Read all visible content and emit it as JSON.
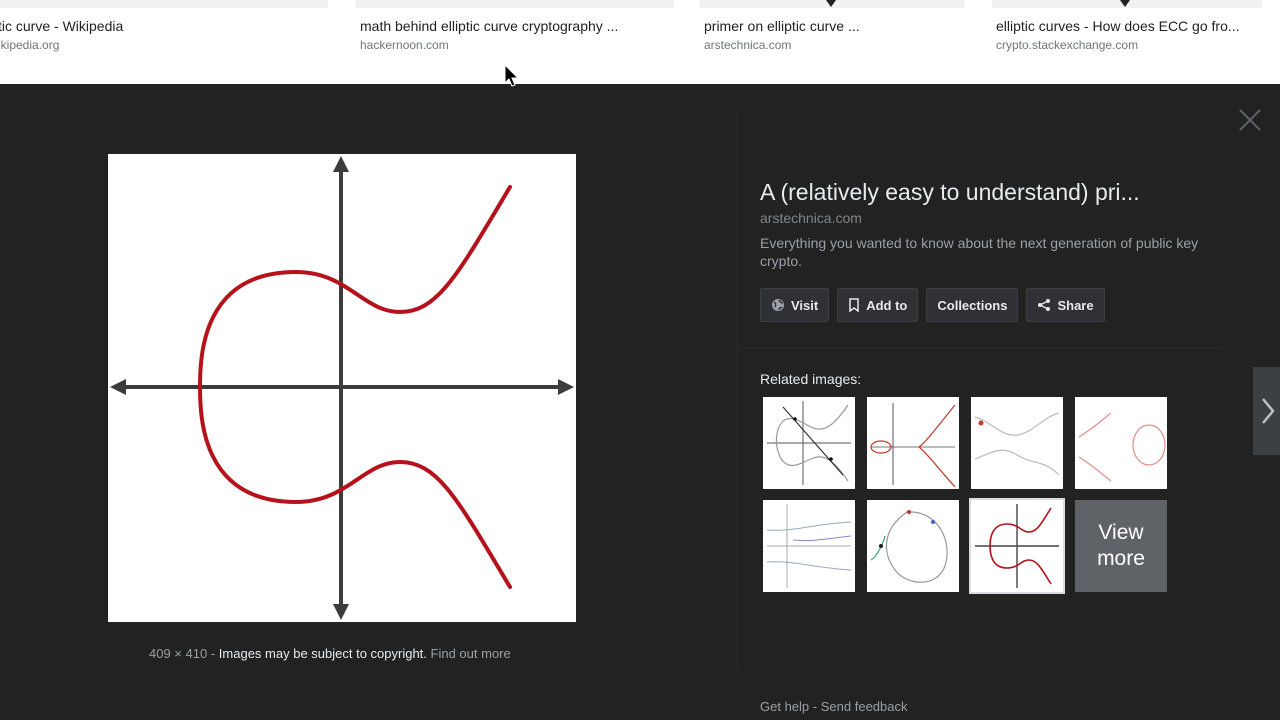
{
  "top_results": [
    {
      "title": "tic curve - Wikipedia",
      "domain": "ikipedia.org"
    },
    {
      "title": "math behind elliptic curve cryptography ...",
      "domain": "hackernoon.com"
    },
    {
      "title": "primer on elliptic curve ...",
      "domain": "arstechnica.com"
    },
    {
      "title": "elliptic curves - How does ECC go fro...",
      "domain": "crypto.stackexchange.com"
    }
  ],
  "panel": {
    "title": "A (relatively easy to understand) pri...",
    "domain": "arstechnica.com",
    "description": "Everything you wanted to know about the next generation of public key crypto.",
    "actions": {
      "visit": "Visit",
      "add_to": "Add to",
      "collections": "Collections",
      "share": "Share"
    },
    "related_label": "Related images:",
    "view_more": "View more",
    "image_size": "409 × 410",
    "separator": "-",
    "copyright": "Images may be subject to copyright.",
    "find_out_more": "Find out more",
    "footer": {
      "help": "Get help",
      "separator": "-",
      "feedback": "Send feedback"
    }
  },
  "colors": {
    "panel_bg": "#222222",
    "curve_red": "#b5121b",
    "axis_dark": "#3c3c3c"
  },
  "icons": [
    "globe-icon",
    "bookmark-icon",
    "share-icon",
    "close-icon",
    "chevron-right-icon",
    "mouse-cursor-icon"
  ]
}
